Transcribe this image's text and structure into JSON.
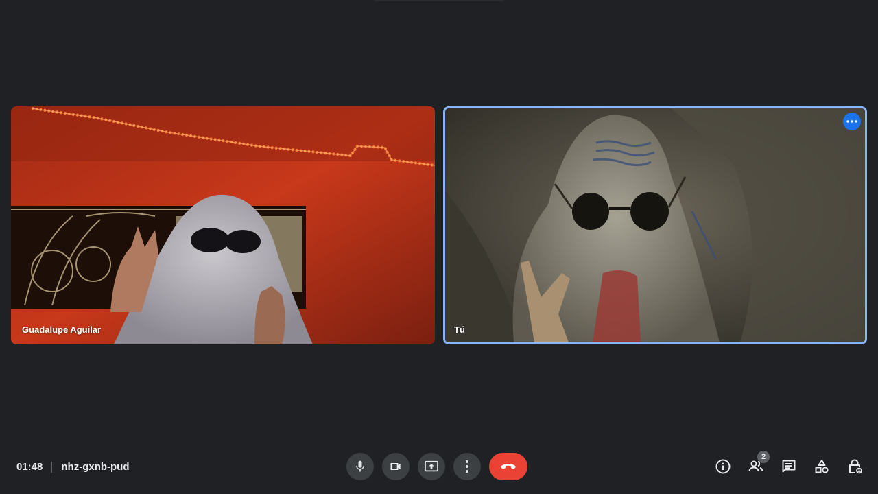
{
  "meeting": {
    "time": "01:48",
    "code": "nhz-gxnb-pud"
  },
  "participants": {
    "remote": {
      "name": "Guadalupe Aguilar"
    },
    "self": {
      "name": "Tú"
    }
  },
  "controls": {
    "mic": {
      "icon": "mic-icon"
    },
    "camera": {
      "icon": "videocam-icon"
    },
    "present": {
      "icon": "present-screen-icon"
    },
    "more": {
      "icon": "more-vert-icon"
    },
    "hangup": {
      "icon": "call-end-icon",
      "color": "#ea4335"
    }
  },
  "side_actions": {
    "info": {
      "icon": "info-icon"
    },
    "people": {
      "icon": "people-icon",
      "badge": "2"
    },
    "chat": {
      "icon": "chat-icon"
    },
    "activities": {
      "icon": "activities-icon"
    },
    "host_controls": {
      "icon": "lock-person-icon"
    }
  },
  "colors": {
    "background": "#202124",
    "control_bg": "#3c4043",
    "active_border": "#8ab4f8",
    "accent": "#1a73e8"
  }
}
